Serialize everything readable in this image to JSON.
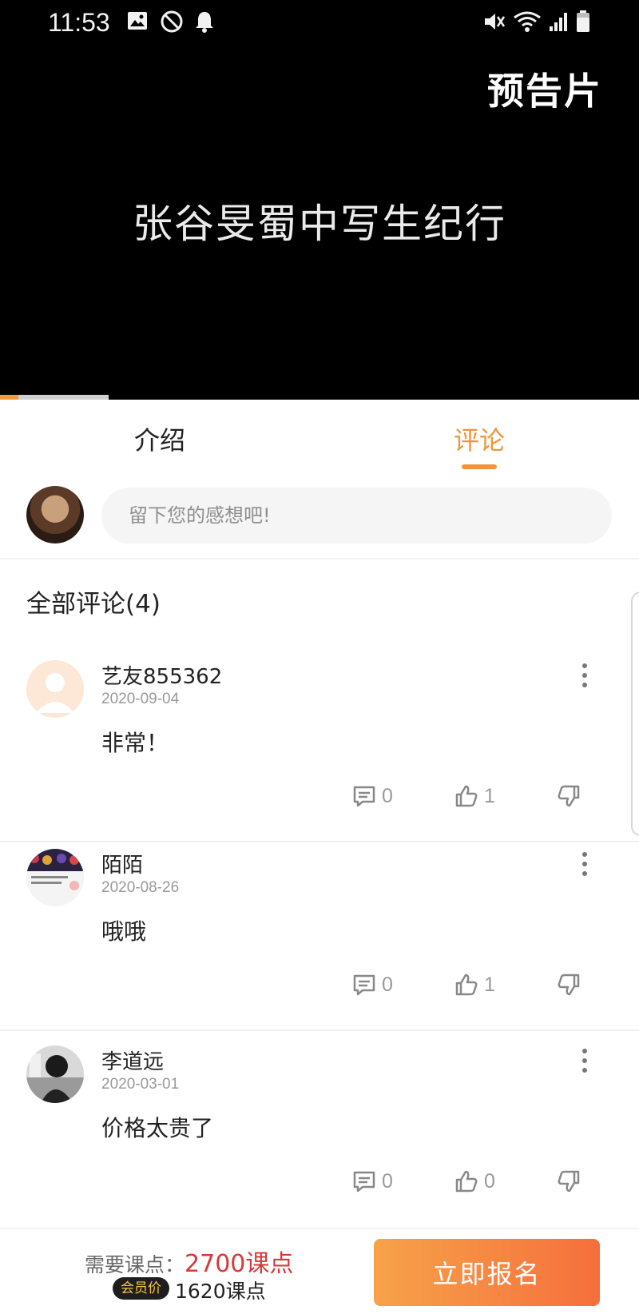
{
  "status_bar": {
    "time": "11:53"
  },
  "video": {
    "badge": "预告片",
    "title": "张谷旻蜀中写生纪行",
    "progress_percent": 17
  },
  "tabs": [
    {
      "label": "介绍",
      "active": false
    },
    {
      "label": "评论",
      "active": true
    }
  ],
  "comment_input": {
    "placeholder": "留下您的感想吧!"
  },
  "comments_section": {
    "header": "全部评论(4)"
  },
  "comments": [
    {
      "author": "艺友855362",
      "date": "2020-09-04",
      "text": "非常！",
      "replies": "0",
      "likes": "1"
    },
    {
      "author": "陌陌",
      "date": "2020-08-26",
      "text": "哦哦",
      "replies": "0",
      "likes": "1"
    },
    {
      "author": "李道远",
      "date": "2020-03-01",
      "text": "价格太贵了",
      "replies": "0",
      "likes": "0"
    }
  ],
  "bottom_bar": {
    "price_label": "需要课点：",
    "price_value": "2700课点",
    "member_badge": "会员价",
    "member_price": "1620课点",
    "signup_button": "立即报名"
  },
  "colors": {
    "accent": "#f0953c",
    "price": "#d33a3a",
    "button_start": "#f7a24a",
    "button_end": "#f56f3c"
  }
}
